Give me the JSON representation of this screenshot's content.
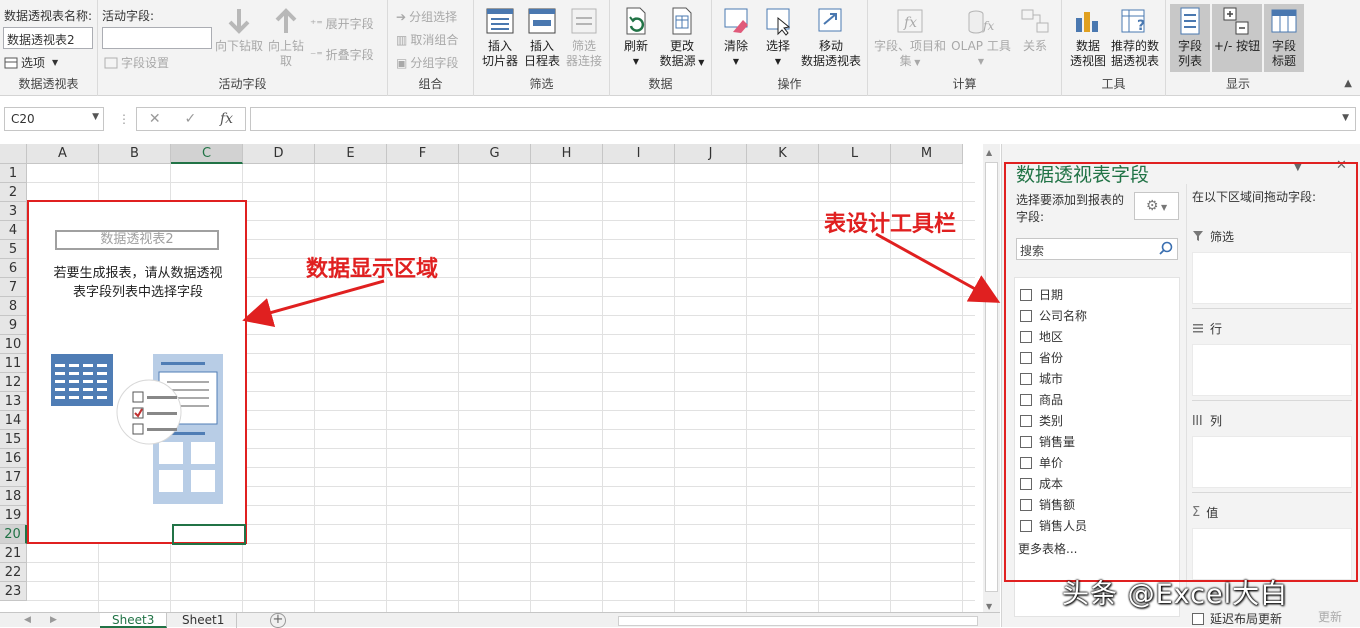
{
  "ribbon": {
    "pivot_group": {
      "name_label": "数据透视表名称:",
      "name_value": "数据透视表2",
      "options_label": "选项",
      "group_label": "数据透视表"
    },
    "active_field_group": {
      "label": "活动字段:",
      "value": "",
      "field_settings": "字段设置",
      "drill_down": "向下钻取",
      "drill_up_1": "向上钻",
      "drill_up_2": "取",
      "expand": "展开字段",
      "collapse": "折叠字段",
      "group_label": "活动字段"
    },
    "grouping_group": {
      "group_selection": "分组选择",
      "ungroup": "取消组合",
      "group_field": "分组字段",
      "group_label": "组合"
    },
    "filter_group": {
      "slicer_1": "插入",
      "slicer_2": "切片器",
      "timeline_1": "插入",
      "timeline_2": "日程表",
      "connections_1": "筛选",
      "connections_2": "器连接",
      "group_label": "筛选"
    },
    "data_group": {
      "refresh": "刷新",
      "change_source_1": "更改",
      "change_source_2": "数据源",
      "group_label": "数据"
    },
    "actions_group": {
      "clear": "清除",
      "select": "选择",
      "move_1": "移动",
      "move_2": "数据透视表",
      "group_label": "操作"
    },
    "calc_group": {
      "fields_items_1": "字段、项目和",
      "fields_items_2": "集",
      "olap_1": "OLAP 工具",
      "relationships": "关系",
      "group_label": "计算"
    },
    "tools_group": {
      "pivotchart_1": "数据",
      "pivotchart_2": "透视图",
      "recommended_1": "推荐的数",
      "recommended_2": "据透视表",
      "group_label": "工具"
    },
    "show_group": {
      "field_list_1": "字段",
      "field_list_2": "列表",
      "buttons": "+/- 按钮",
      "headers_1": "字段",
      "headers_2": "标题",
      "group_label": "显示"
    }
  },
  "formula_bar": {
    "name_box": "C20",
    "cancel": "✕",
    "enter": "✓",
    "fx": "fx",
    "content": ""
  },
  "grid": {
    "columns": [
      "A",
      "B",
      "C",
      "D",
      "E",
      "F",
      "G",
      "H",
      "I",
      "J",
      "K",
      "L",
      "M"
    ],
    "rows": [
      "1",
      "2",
      "3",
      "4",
      "5",
      "6",
      "7",
      "8",
      "9",
      "10",
      "11",
      "12",
      "13",
      "14",
      "15",
      "16",
      "17",
      "18",
      "19",
      "20",
      "21",
      "22",
      "23"
    ],
    "selected_column": "C",
    "selected_row": "20"
  },
  "pivot_placeholder": {
    "title": "数据透视表2",
    "message_line1": "若要生成报表，请从数据透视",
    "message_line2": "表字段列表中选择字段"
  },
  "annotations": {
    "data_area": "数据显示区域",
    "design_toolbar": "表设计工具栏"
  },
  "sheet_tabs": {
    "active": "Sheet3",
    "other": "Sheet1",
    "add": "+"
  },
  "field_pane": {
    "title": "数据透视表字段",
    "choose_label": "选择要添加到报表的字段:",
    "drag_label": "在以下区域间拖动字段:",
    "search_placeholder": "搜索",
    "fields": [
      "日期",
      "公司名称",
      "地区",
      "省份",
      "城市",
      "商品",
      "类别",
      "销售量",
      "单价",
      "成本",
      "销售额",
      "销售人员"
    ],
    "more_tables": "更多表格...",
    "areas": {
      "filters": "筛选",
      "rows": "行",
      "columns": "列",
      "values": "值"
    },
    "defer_update": "延迟布局更新",
    "update_button": "更新"
  },
  "watermark": "头条 @Excel大白",
  "colors": {
    "excel_green": "#217346",
    "annotation_red": "#e02020",
    "ribbon_bg": "#f3f3f3"
  }
}
